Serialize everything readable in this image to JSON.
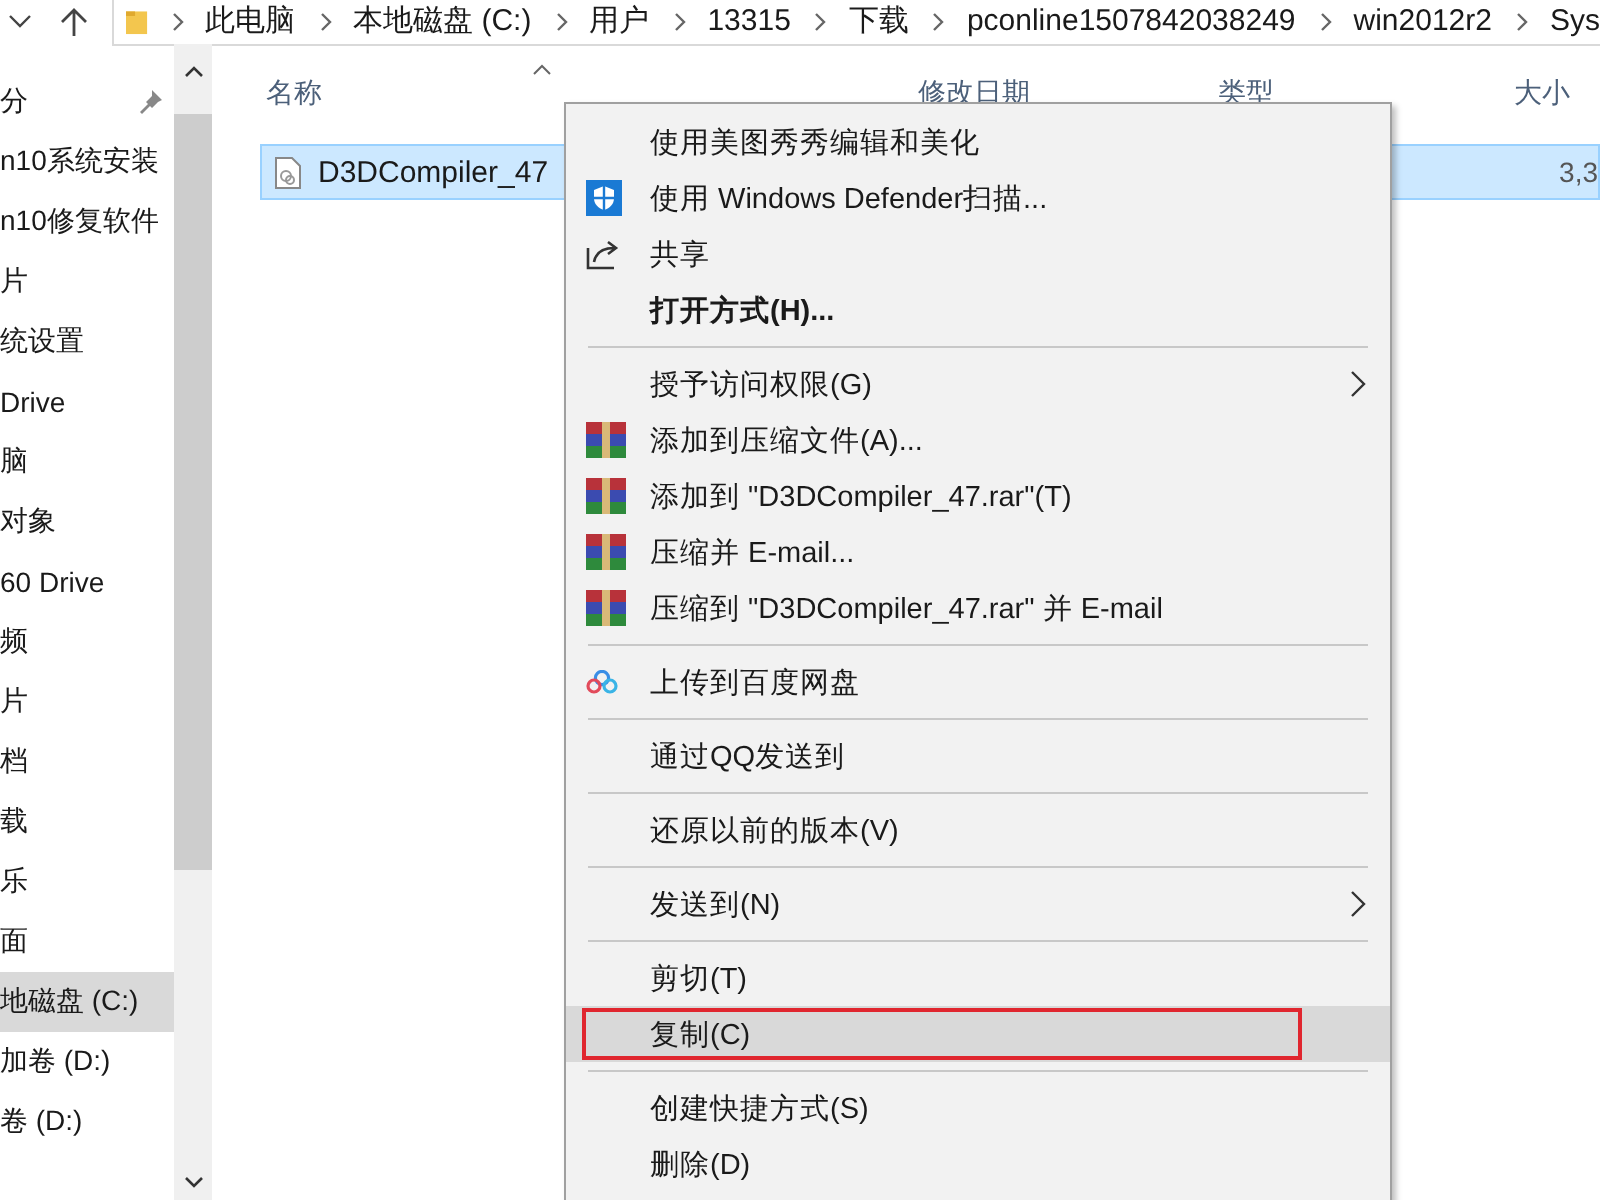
{
  "breadcrumb": [
    "此电脑",
    "本地磁盘 (C:)",
    "用户",
    "13315",
    "下载",
    "pconline1507842038249",
    "win2012r2",
    "Sys"
  ],
  "sidebar": {
    "items": [
      {
        "label": "分",
        "pinned": true,
        "selected": false
      },
      {
        "label": "n10系统安装",
        "pinned": false,
        "selected": false
      },
      {
        "label": "n10修复软件",
        "pinned": false,
        "selected": false
      },
      {
        "label": "片",
        "pinned": false,
        "selected": false
      },
      {
        "label": "统设置",
        "pinned": false,
        "selected": false
      },
      {
        "label": "Drive",
        "pinned": false,
        "selected": false
      },
      {
        "label": "脑",
        "pinned": false,
        "selected": false
      },
      {
        "label": "对象",
        "pinned": false,
        "selected": false
      },
      {
        "label": "60 Drive",
        "pinned": false,
        "selected": false
      },
      {
        "label": "频",
        "pinned": false,
        "selected": false
      },
      {
        "label": "片",
        "pinned": false,
        "selected": false
      },
      {
        "label": "档",
        "pinned": false,
        "selected": false
      },
      {
        "label": "载",
        "pinned": false,
        "selected": false
      },
      {
        "label": "乐",
        "pinned": false,
        "selected": false
      },
      {
        "label": "面",
        "pinned": false,
        "selected": false
      },
      {
        "label": "地磁盘 (C:)",
        "pinned": false,
        "selected": true
      },
      {
        "label": "加卷 (D:)",
        "pinned": false,
        "selected": false
      },
      {
        "label": "卷 (D:)",
        "pinned": false,
        "selected": false
      }
    ]
  },
  "table": {
    "columns": [
      "名称",
      "修改日期",
      "类型",
      "大小"
    ],
    "rows": [
      {
        "name": "D3DCompiler_47",
        "size": "3,3",
        "selected": true
      }
    ]
  },
  "context_menu": {
    "items": [
      {
        "kind": "item",
        "label": "使用美图秀秀编辑和美化",
        "bold": false,
        "submenu": false,
        "selected": false
      },
      {
        "kind": "shield",
        "label": "使用 Windows Defender扫描...",
        "bold": false,
        "submenu": false,
        "selected": false
      },
      {
        "kind": "share",
        "label": "共享",
        "bold": false,
        "submenu": false,
        "selected": false
      },
      {
        "kind": "item",
        "label": "打开方式(H)...",
        "bold": true,
        "submenu": false,
        "selected": false
      },
      {
        "kind": "separator"
      },
      {
        "kind": "item",
        "label": "授予访问权限(G)",
        "bold": false,
        "submenu": true,
        "selected": false
      },
      {
        "kind": "archive",
        "label": "添加到压缩文件(A)...",
        "bold": false,
        "submenu": false,
        "selected": false
      },
      {
        "kind": "archive",
        "label": "添加到 \"D3DCompiler_47.rar\"(T)",
        "bold": false,
        "submenu": false,
        "selected": false
      },
      {
        "kind": "archive",
        "label": "压缩并 E-mail...",
        "bold": false,
        "submenu": false,
        "selected": false
      },
      {
        "kind": "archive",
        "label": "压缩到 \"D3DCompiler_47.rar\" 并 E-mail",
        "bold": false,
        "submenu": false,
        "selected": false
      },
      {
        "kind": "separator"
      },
      {
        "kind": "cloud",
        "label": "上传到百度网盘",
        "bold": false,
        "submenu": false,
        "selected": false
      },
      {
        "kind": "separator"
      },
      {
        "kind": "item",
        "label": "通过QQ发送到",
        "bold": false,
        "submenu": false,
        "selected": false
      },
      {
        "kind": "separator"
      },
      {
        "kind": "item",
        "label": "还原以前的版本(V)",
        "bold": false,
        "submenu": false,
        "selected": false
      },
      {
        "kind": "separator"
      },
      {
        "kind": "item",
        "label": "发送到(N)",
        "bold": false,
        "submenu": true,
        "selected": false
      },
      {
        "kind": "separator"
      },
      {
        "kind": "item",
        "label": "剪切(T)",
        "bold": false,
        "submenu": false,
        "selected": false
      },
      {
        "kind": "item",
        "label": "复制(C)",
        "bold": false,
        "submenu": false,
        "selected": true
      },
      {
        "kind": "separator"
      },
      {
        "kind": "item",
        "label": "创建快捷方式(S)",
        "bold": false,
        "submenu": false,
        "selected": false
      },
      {
        "kind": "item",
        "label": "删除(D)",
        "bold": false,
        "submenu": false,
        "selected": false
      }
    ]
  }
}
